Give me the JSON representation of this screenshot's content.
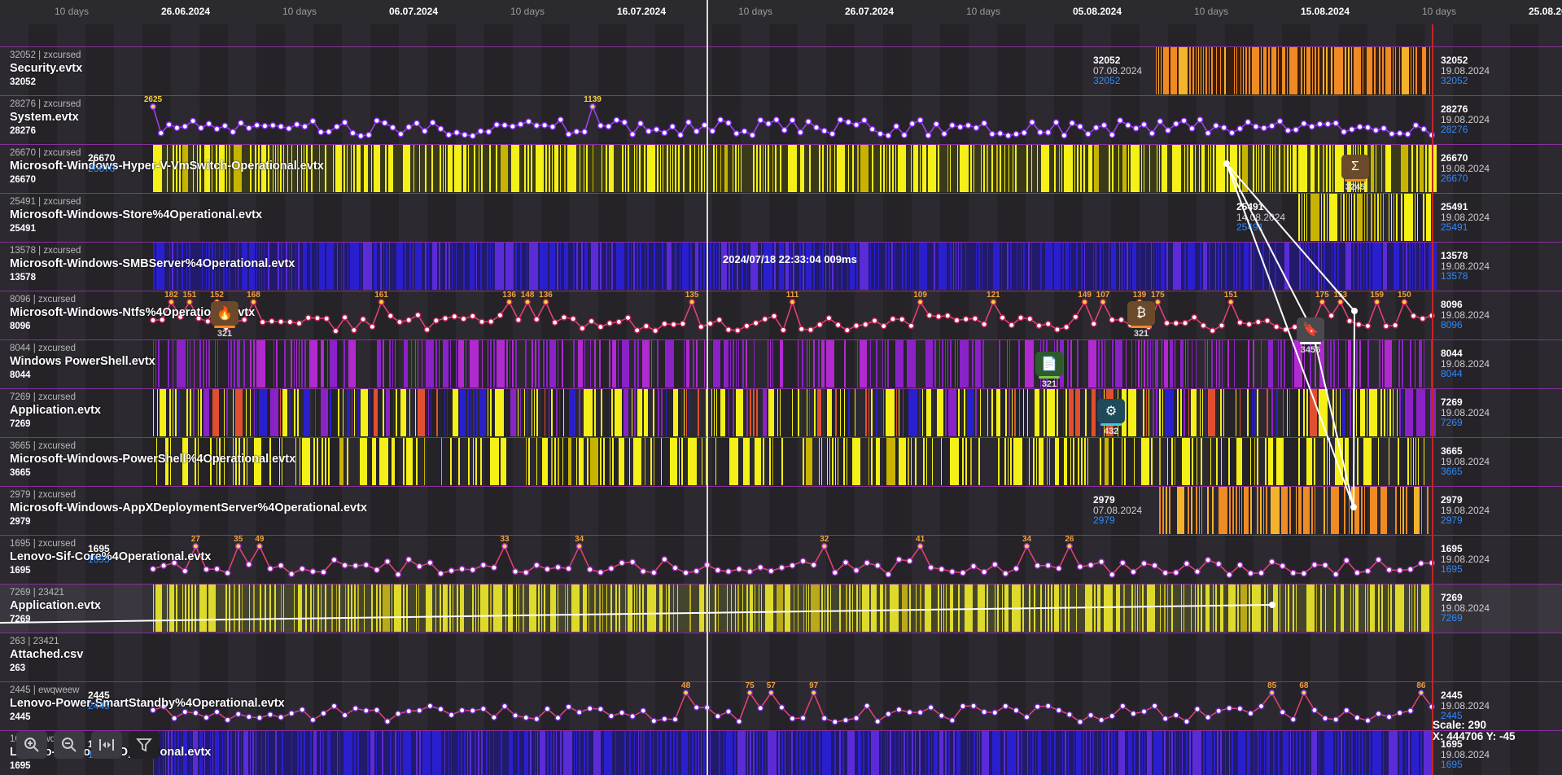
{
  "timeline": {
    "ticks": [
      {
        "text": "10 days",
        "kind": "span"
      },
      {
        "text": "26.06.2024",
        "kind": "date"
      },
      {
        "text": "10 days",
        "kind": "span"
      },
      {
        "text": "06.07.2024",
        "kind": "date"
      },
      {
        "text": "10 days",
        "kind": "span"
      },
      {
        "text": "16.07.2024",
        "kind": "date"
      },
      {
        "text": "10 days",
        "kind": "span"
      },
      {
        "text": "26.07.2024",
        "kind": "date"
      },
      {
        "text": "10 days",
        "kind": "span"
      },
      {
        "text": "05.08.2024",
        "kind": "date"
      },
      {
        "text": "10 days",
        "kind": "span"
      },
      {
        "text": "15.08.2024",
        "kind": "date"
      },
      {
        "text": "10 days",
        "kind": "span"
      },
      {
        "text": "25.08.2024",
        "kind": "date"
      }
    ],
    "cursor_time": "2024/07/18 22:33:04 009ms"
  },
  "rows": [
    {
      "meta": "32052 | zxcursed",
      "name": "Security.evtx",
      "count": "32052",
      "style": "orange",
      "end_count": "32052",
      "end_date": "19.08.2024",
      "end_blue": "32052",
      "start_count": "32052",
      "start_date": "07.08.2024",
      "start_blue": "32052"
    },
    {
      "meta": "28276 | zxcursed",
      "name": "System.evtx",
      "count": "28276",
      "style": "line",
      "end_count": "28276",
      "end_date": "19.08.2024",
      "end_blue": "28276"
    },
    {
      "meta": "26670 | zxcursed",
      "name": "Microsoft-Windows-Hyper-V-VmSwitch-Operational.evtx",
      "count": "26670",
      "style": "yellow",
      "end_count": "26670",
      "end_date": "19.08.2024",
      "end_blue": "26670",
      "start_count": "26670",
      "start_date": "",
      "start_blue": "26670"
    },
    {
      "meta": "25491 | zxcursed",
      "name": "Microsoft-Windows-Store%4Operational.evtx",
      "count": "25491",
      "style": "yellow-late",
      "end_count": "25491",
      "end_date": "19.08.2024",
      "end_blue": "25491",
      "start_count": "25491",
      "start_date": "14.08.2024",
      "start_blue": "25491"
    },
    {
      "meta": "13578 | zxcursed",
      "name": "Microsoft-Windows-SMBServer%4Operational.evtx",
      "count": "13578",
      "style": "blue",
      "end_count": "13578",
      "end_date": "19.08.2024",
      "end_blue": "13578"
    },
    {
      "meta": "8096 | zxcursed",
      "name": "Microsoft-Windows-Ntfs%4Operational.evtx",
      "count": "8096",
      "style": "line-orange",
      "end_count": "8096",
      "end_date": "19.08.2024",
      "end_blue": "8096"
    },
    {
      "meta": "8044 | zxcursed",
      "name": "Windows PowerShell.evtx",
      "count": "8044",
      "style": "purple",
      "end_count": "8044",
      "end_date": "19.08.2024",
      "end_blue": "8044"
    },
    {
      "meta": "7269 | zxcursed",
      "name": "Application.evtx",
      "count": "7269",
      "style": "mixed",
      "end_count": "7269",
      "end_date": "19.08.2024",
      "end_blue": "7269"
    },
    {
      "meta": "3665 | zxcursed",
      "name": "Microsoft-Windows-PowerShell%4Operational.evtx",
      "count": "3665",
      "style": "yellow-sparse",
      "end_count": "3665",
      "end_date": "19.08.2024",
      "end_blue": "3665"
    },
    {
      "meta": "2979 | zxcursed",
      "name": "Microsoft-Windows-AppXDeploymentServer%4Operational.evtx",
      "count": "2979",
      "style": "orange-late",
      "end_count": "2979",
      "end_date": "19.08.2024",
      "end_blue": "2979",
      "start_count": "2979",
      "start_date": "07.08.2024",
      "start_blue": "2979"
    },
    {
      "meta": "1695 | zxcursed",
      "name": "Lenovo-Sif-Core%4Operational.evtx",
      "count": "1695",
      "style": "line-red",
      "end_count": "1695",
      "end_date": "19.08.2024",
      "end_blue": "1695",
      "start_count": "1695",
      "start_date": "",
      "start_blue": "1695"
    },
    {
      "meta": "7269 | 23421",
      "name": "Application.evtx",
      "count": "7269",
      "style": "yellow",
      "end_count": "7269",
      "end_date": "19.08.2024",
      "end_blue": "7269",
      "selected": true
    },
    {
      "meta": "263 | 23421",
      "name": "Attached.csv",
      "count": "263",
      "style": "none",
      "end_count": "",
      "end_date": "",
      "end_blue": ""
    },
    {
      "meta": "2445 | ewqweew",
      "name": "Lenovo-Power-SmartStandby%4Operational.evtx",
      "count": "2445",
      "style": "line-red2",
      "end_count": "2445",
      "end_date": "19.08.2024",
      "end_blue": "2445",
      "start_count": "2445",
      "start_date": "",
      "start_blue": "2445"
    },
    {
      "meta": "1695 | ewqweew",
      "name": "Lenovo-Sif-Core%4Operational.evtx",
      "count": "1695",
      "style": "blue",
      "end_count": "1695",
      "end_date": "19.08.2024",
      "end_blue": "1695",
      "start_count": "1695",
      "start_date": "",
      "start_blue": "1695"
    }
  ],
  "markers": [
    {
      "icon": "flame-icon",
      "glyph": "🔥",
      "label": "321",
      "color": "#6a4a2a",
      "bar": "#f08a24"
    },
    {
      "icon": "sigma-icon",
      "glyph": "Σ",
      "label": "3245",
      "color": "#6a4a2a",
      "bar": "#f08a24"
    },
    {
      "icon": "bitcoin-icon",
      "glyph": "₿",
      "label": "321",
      "color": "#6a4a2a",
      "bar": "#f08a24"
    },
    {
      "icon": "bookmark-icon",
      "glyph": "🔖",
      "label": "3456",
      "color": "#4a4a4e",
      "bar": "#ffffff"
    },
    {
      "icon": "document-icon",
      "glyph": "📄",
      "label": "321",
      "color": "#2e5a2e",
      "bar": "#7ac943"
    },
    {
      "icon": "gear-icon",
      "glyph": "⚙",
      "label": "432",
      "color": "#1e4a5a",
      "bar": "#3ec8e8"
    }
  ],
  "peaks": {
    "system": [
      "2625",
      "1139"
    ],
    "ntfs": [
      "182",
      "151",
      "152",
      "168",
      "161",
      "136",
      "148",
      "136",
      "135",
      "111",
      "109",
      "121",
      "149",
      "107",
      "139",
      "175",
      "151",
      "175",
      "153",
      "159",
      "150"
    ],
    "sif": [
      "49",
      "35",
      "34",
      "32",
      "41",
      "33",
      "34",
      "27",
      "26"
    ],
    "power": [
      "97",
      "75",
      "57",
      "85",
      "68",
      "86",
      "48"
    ]
  },
  "toolbar": {
    "zoom_in": "zoom-in-icon",
    "zoom_out": "zoom-out-icon",
    "fit": "fit-width-icon",
    "filter": "filter-icon"
  },
  "status": {
    "scale": "Scale: 290",
    "coords": "X: 444706 Y: -45"
  },
  "colors": {
    "row_border": "#8a2f9e",
    "yellow": "#f4f018",
    "orange": "#f08a24",
    "blue": "#2a1fcf",
    "purple": "#8a22c8",
    "cursor": "#d8d8d8",
    "end_line": "#c0262c"
  }
}
